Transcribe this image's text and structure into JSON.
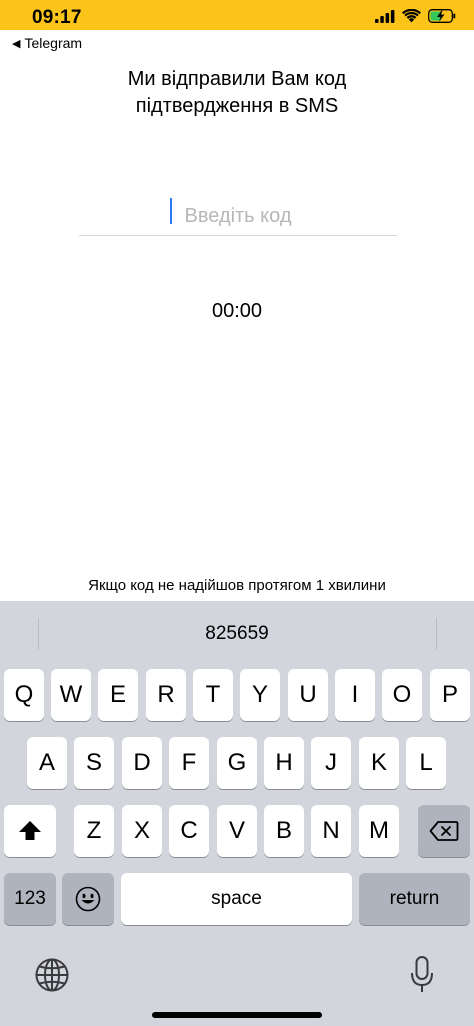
{
  "status_bar": {
    "time": "09:17",
    "accent_color": "#fcc419"
  },
  "back_nav": {
    "label": "Telegram"
  },
  "heading": {
    "line1": "Ми відправили Вам код",
    "line2": "підтвердження в SMS"
  },
  "code_field": {
    "value": "",
    "placeholder": "Введіть код"
  },
  "timer": {
    "text": "00:00"
  },
  "hint": {
    "line1": "Якщо код не надійшов протягом 1 хвилини"
  },
  "keyboard": {
    "suggestion": "825659",
    "row1": [
      "Q",
      "W",
      "E",
      "R",
      "T",
      "Y",
      "U",
      "I",
      "O",
      "P"
    ],
    "row2": [
      "A",
      "S",
      "D",
      "F",
      "G",
      "H",
      "J",
      "K",
      "L"
    ],
    "row3": [
      "Z",
      "X",
      "C",
      "V",
      "B",
      "N",
      "M"
    ],
    "numbers_label": "123",
    "space_label": "space",
    "return_label": "return",
    "icons": {
      "shift": "shift-icon",
      "delete": "backspace-icon",
      "emoji": "emoji-icon",
      "globe": "globe-icon",
      "mic": "microphone-icon"
    }
  }
}
